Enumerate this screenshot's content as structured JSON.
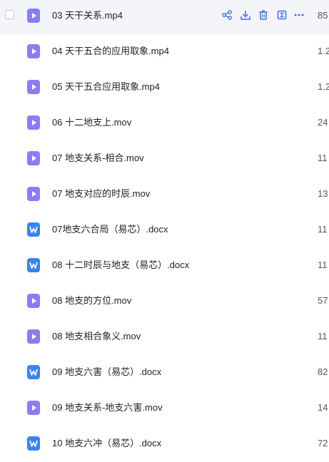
{
  "colors": {
    "accent": "#3b6cf6",
    "video_icon": "#8b7cf6",
    "doc_icon": "#3b82f6",
    "hover_bg": "#f4f5f8"
  },
  "row_actions": [
    "share-icon",
    "download-icon",
    "delete-icon",
    "open-icon",
    "more-icon"
  ],
  "files": [
    {
      "name": "03 天干关系.mp4",
      "type": "video",
      "size": "85"
    },
    {
      "name": "04 天干五合的应用取象.mp4",
      "type": "video",
      "size": "1.2"
    },
    {
      "name": "05 天干五合应用取象.mp4",
      "type": "video",
      "size": "1.2"
    },
    {
      "name": "06 十二地支上.mov",
      "type": "video",
      "size": "24"
    },
    {
      "name": "07 地支关系-相合.mov",
      "type": "video",
      "size": "11"
    },
    {
      "name": "07 地支对应的时辰.mov",
      "type": "video",
      "size": "13"
    },
    {
      "name": "07地支六合局（易芯）.docx",
      "type": "doc",
      "size": "11"
    },
    {
      "name": "08 十二时辰与地支（易芯）.docx",
      "type": "doc",
      "size": "11"
    },
    {
      "name": "08 地支的方位.mov",
      "type": "video",
      "size": "57"
    },
    {
      "name": "08 地支相合象义.mov",
      "type": "video",
      "size": "11"
    },
    {
      "name": "09 地支六害（易芯）.docx",
      "type": "doc",
      "size": "82"
    },
    {
      "name": "09 地支关系-地支六害.mov",
      "type": "video",
      "size": "14"
    },
    {
      "name": "10 地支六冲（易芯）.docx",
      "type": "doc",
      "size": "72"
    }
  ]
}
